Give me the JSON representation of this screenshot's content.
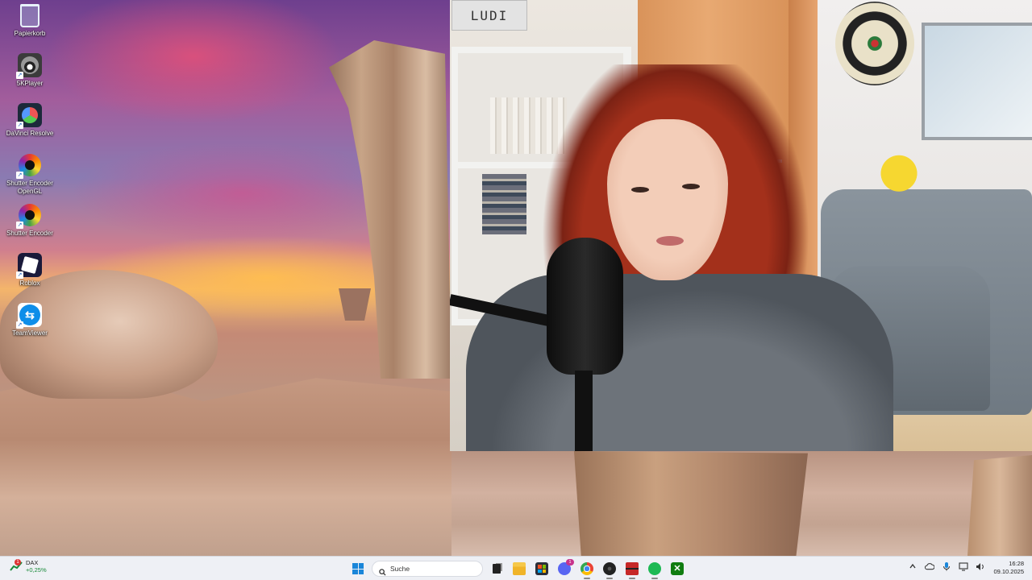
{
  "desktop": {
    "icons": [
      {
        "label": "Papierkorb",
        "icon": "recycle-bin-icon"
      },
      {
        "label": "5KPlayer",
        "icon": "5kplayer-icon"
      },
      {
        "label": "DaVinci Resolve",
        "icon": "davinci-resolve-icon"
      },
      {
        "label": "Shutter Encoder OpenGL",
        "icon": "shutter-encoder-icon"
      },
      {
        "label": "Shutter Encoder",
        "icon": "shutter-encoder-icon"
      },
      {
        "label": "Roblox",
        "icon": "roblox-icon"
      },
      {
        "label": "TeamViewer",
        "icon": "teamviewer-icon"
      }
    ]
  },
  "webcam": {
    "sign_text": "LUDI"
  },
  "taskbar": {
    "widget": {
      "name": "DAX",
      "change": "+0,25%",
      "badge": "1",
      "change_color": "#1a8a3a"
    },
    "search": {
      "placeholder": "Suche"
    },
    "apps": [
      {
        "name": "task-view",
        "icon": "task-view-icon"
      },
      {
        "name": "file-explorer",
        "icon": "folder-icon"
      },
      {
        "name": "microsoft-store",
        "icon": "store-icon"
      },
      {
        "name": "discord",
        "icon": "discord-icon",
        "badge": "1"
      },
      {
        "name": "chrome",
        "icon": "chrome-icon"
      },
      {
        "name": "obs",
        "icon": "obs-icon"
      },
      {
        "name": "voicemeeter",
        "icon": "voicemeeter-icon"
      },
      {
        "name": "spotify",
        "icon": "spotify-icon"
      },
      {
        "name": "xbox",
        "icon": "xbox-icon"
      }
    ],
    "tray": {
      "icons": [
        "chevron-up-icon",
        "cloud-icon",
        "microphone-icon",
        "monitor-icon",
        "volume-icon"
      ]
    },
    "clock": {
      "time": "16:28",
      "date": "09.10.2025"
    }
  },
  "colors": {
    "accent": "#1a86d9",
    "taskbar_bg": "#eef0f5"
  }
}
